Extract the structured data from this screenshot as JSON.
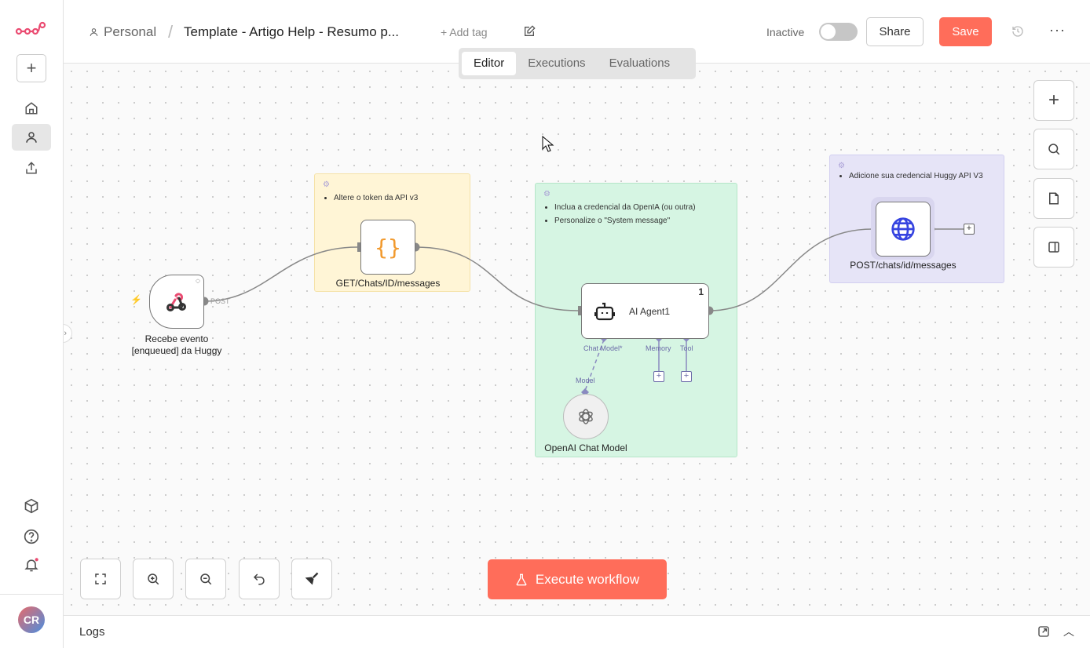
{
  "sidebar": {
    "avatar": "CR",
    "items": [
      "home",
      "personal",
      "shared"
    ],
    "bottom": [
      "templates",
      "help",
      "notifications"
    ]
  },
  "header": {
    "project": "Personal",
    "separator": "/",
    "title": "Template - Artigo Help - Resumo p...",
    "add_tag": "+ Add tag",
    "status": "Inactive",
    "active": false,
    "share": "Share",
    "save": "Save",
    "tabs": [
      {
        "label": "Editor",
        "active": true
      },
      {
        "label": "Executions"
      },
      {
        "label": "Evaluations"
      }
    ]
  },
  "colors": {
    "accent": "#ff6d5a",
    "sticky_yellow": "#fff5d6",
    "sticky_green": "#d6f5e3",
    "sticky_purple": "#e6e4f7"
  },
  "stickies": {
    "yellow": [
      "Altere o token da API v3"
    ],
    "green": [
      "Inclua a credencial da OpenIA (ou outra)",
      "Personalize o \"System message\""
    ],
    "purple": [
      "Adicione sua credencial Huggy API V3"
    ]
  },
  "nodes": {
    "webhook": {
      "label": "Recebe evento [enqueued] da Huggy",
      "output": "POST"
    },
    "code": {
      "label": "GET/Chats/ID/messages"
    },
    "agent": {
      "label": "AI Agent1",
      "badge": "1",
      "inputs": [
        "Chat Model*",
        "Memory",
        "Tool"
      ]
    },
    "openai": {
      "label": "OpenAI Chat Model",
      "output": "Model"
    },
    "http": {
      "label": "POST/chats/id/messages"
    }
  },
  "footer": {
    "execute": "Execute workflow",
    "logs": "Logs"
  }
}
